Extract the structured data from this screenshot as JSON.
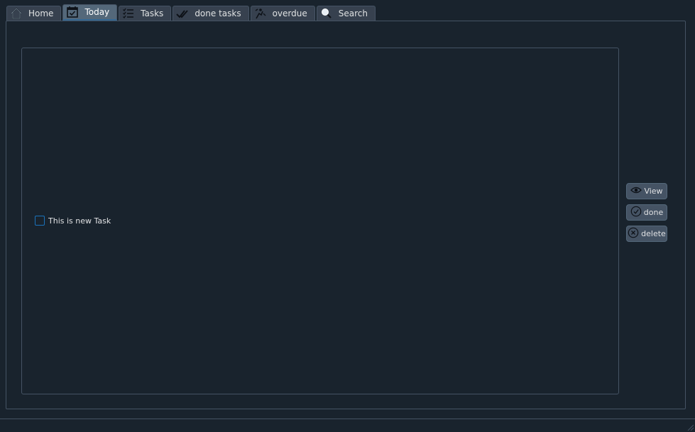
{
  "tabs": [
    {
      "label": "Home",
      "icon": "home-icon",
      "active": false
    },
    {
      "label": "Today",
      "icon": "calendar-check-icon",
      "active": true
    },
    {
      "label": "Tasks",
      "icon": "checklist-icon",
      "active": false
    },
    {
      "label": "done tasks",
      "icon": "double-check-icon",
      "active": false
    },
    {
      "label": "overdue",
      "icon": "overdue-icon",
      "active": false
    },
    {
      "label": "Search",
      "icon": "magnifier-icon",
      "active": false
    }
  ],
  "task_list": {
    "items": [
      {
        "label": "This is new Task",
        "checked": false
      }
    ]
  },
  "actions": {
    "view_label": "View",
    "done_label": "done",
    "delete_label": "delete"
  },
  "colors": {
    "background": "#19232d",
    "tab_active": "#54687a",
    "accent": "#1a72bb"
  }
}
